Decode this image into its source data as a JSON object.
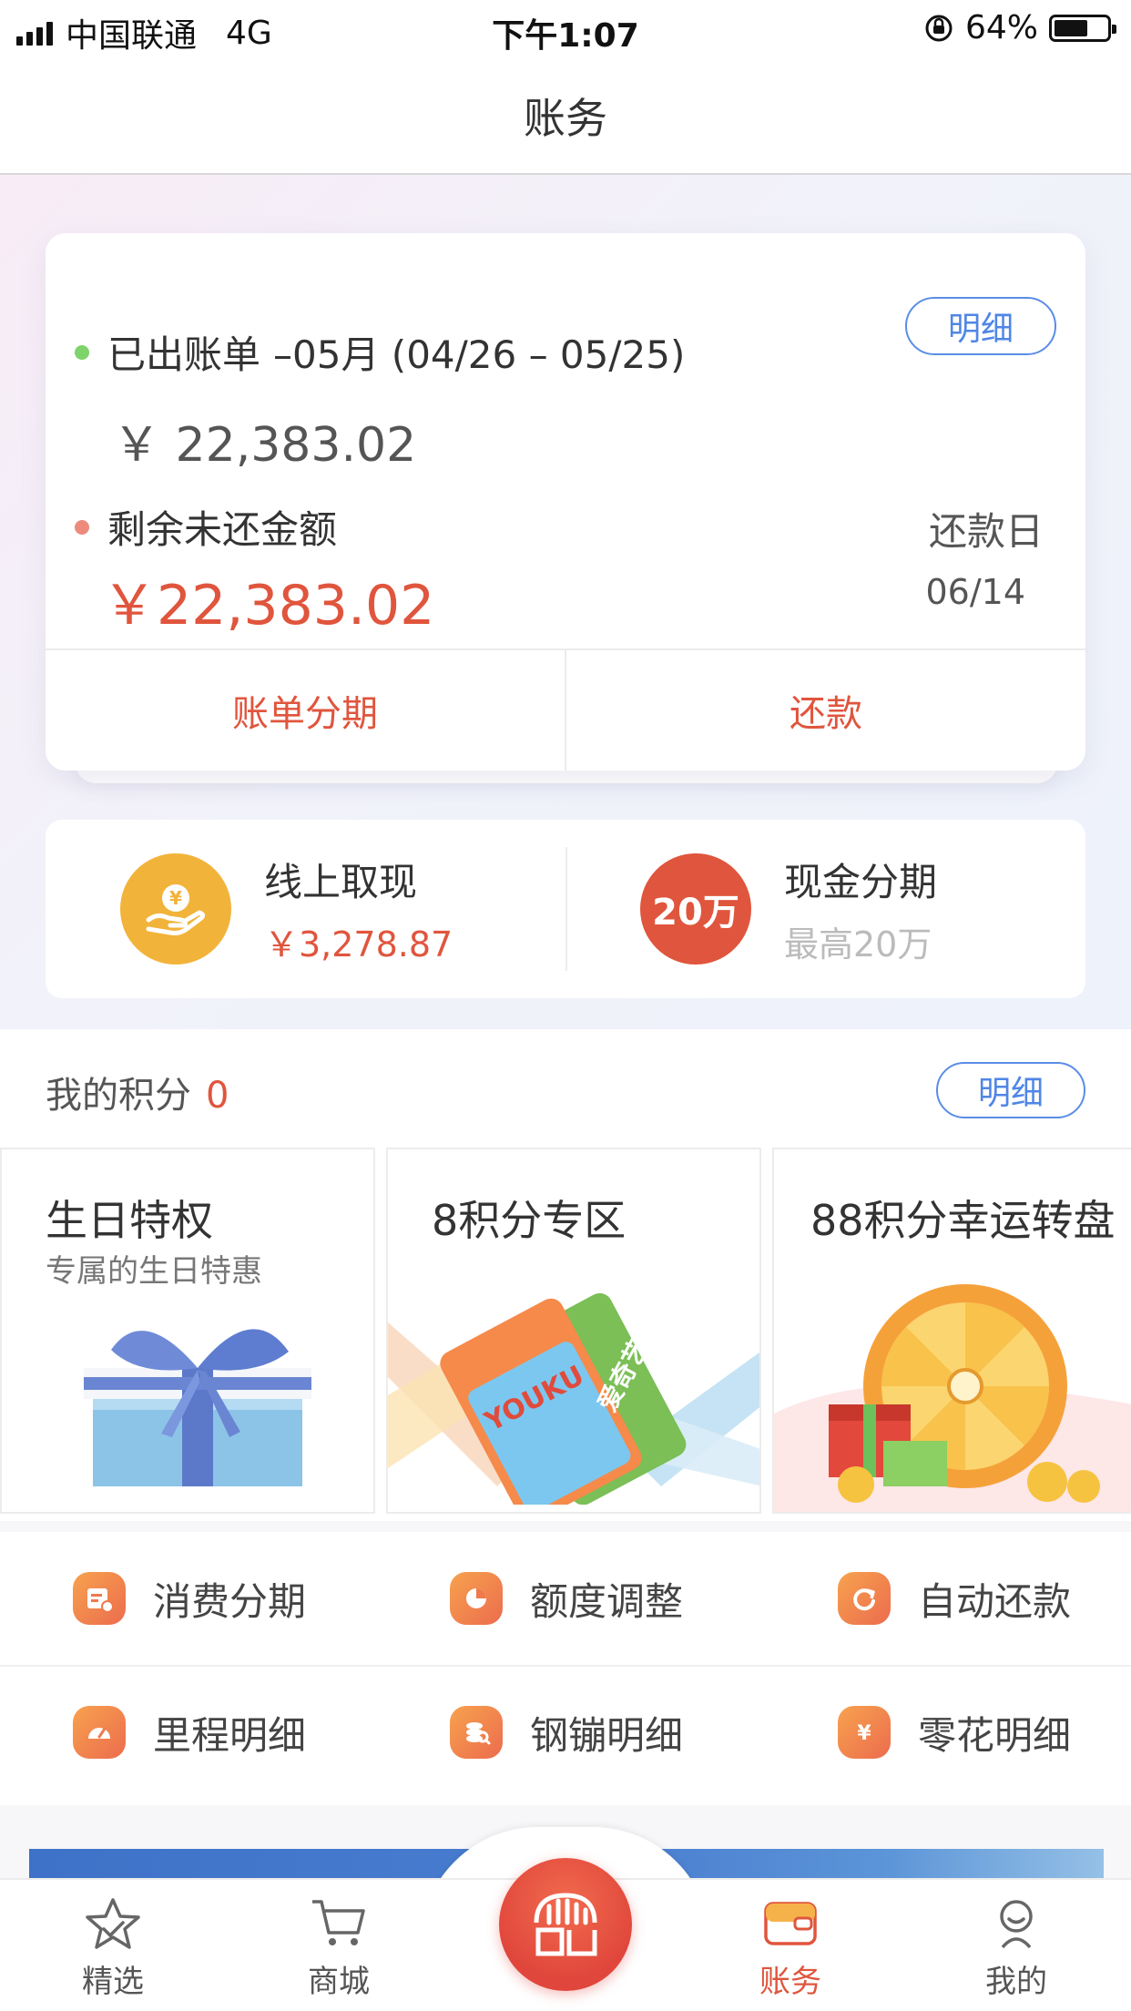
{
  "status_bar": {
    "carrier": "中国联通",
    "network": "4G",
    "time": "下午1:07",
    "battery_text": "64%",
    "battery_level": 0.64
  },
  "nav": {
    "title": "账务"
  },
  "bill": {
    "issued_label": "已出账单",
    "period": "–05月 (04/26 – 05/25)",
    "detail_label": "明细",
    "amount": "￥ 22,383.02",
    "remaining_label": "剩余未还金额",
    "remaining_amount": "￥22,383.02",
    "due_label": "还款日",
    "due_date": "06/14",
    "actions": {
      "installment": "账单分期",
      "repay": "还款"
    }
  },
  "cash": {
    "withdraw_title": "线上取现",
    "withdraw_amount": "￥3,278.87",
    "installment_badge": "20万",
    "installment_title": "现金分期",
    "installment_sub": "最高20万"
  },
  "points": {
    "label": "我的积分",
    "value": "0",
    "detail_label": "明细",
    "promos": [
      {
        "title": "生日特权",
        "subtitle": "专属的生日特惠"
      },
      {
        "title": "8积分专区",
        "card_a": "YOUKU",
        "card_b": "爱奇艺"
      },
      {
        "title": "88积分幸运转盘"
      }
    ]
  },
  "shortcuts": [
    {
      "label": "消费分期",
      "icon": "installment-icon"
    },
    {
      "label": "额度调整",
      "icon": "limit-pie-icon"
    },
    {
      "label": "自动还款",
      "icon": "auto-repay-icon"
    },
    {
      "label": "里程明细",
      "icon": "mileage-gauge-icon"
    },
    {
      "label": "钢镚明细",
      "icon": "coin-search-icon"
    },
    {
      "label": "零花明细",
      "icon": "yuan-icon"
    }
  ],
  "tabs": [
    {
      "label": "精选",
      "icon": "star-icon"
    },
    {
      "label": "商城",
      "icon": "cart-icon"
    },
    {
      "label": "",
      "icon": "home-logo-icon"
    },
    {
      "label": "账务",
      "icon": "wallet-icon",
      "active": true
    },
    {
      "label": "我的",
      "icon": "user-icon"
    }
  ],
  "colors": {
    "accent_red": "#e0553d",
    "link_blue": "#4f86e6",
    "gold": "#f2b33a",
    "dot_green": "#7ed36a",
    "dot_red": "#ec8a7c"
  }
}
